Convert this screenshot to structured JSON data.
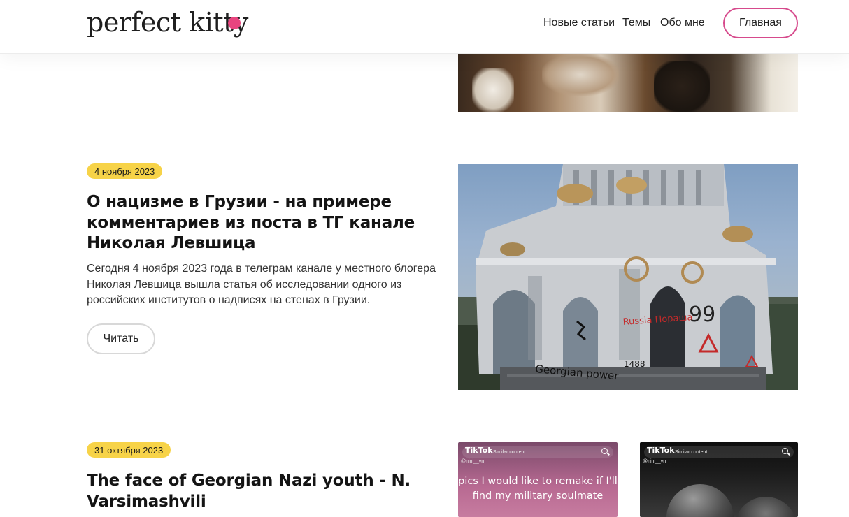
{
  "header": {
    "logo": "perfect kitty",
    "nav": [
      "Новые статьи",
      "Темы",
      "Обо мне"
    ],
    "home_button": "Главная"
  },
  "articles": [
    {
      "date": "4 ноября 2023",
      "title": "О нацизме в Грузии - на примере комментариев из поста в ТГ канале Николая Левшица",
      "excerpt": "Сегодня 4 ноября 2023 года в телеграм канале у местного блогера Николая Левшица вышла статья об исследовании одного из российских институтов о надписях на стенах в Грузии.",
      "read_button": "Читать",
      "image_graffiti": [
        "Georgian power",
        "Russia Пораша",
        "1488",
        "99"
      ]
    },
    {
      "date": "31 октября 2023",
      "title": "The face of Georgian Nazi youth - N. Varsimashvili",
      "thumbs": [
        {
          "brand": "TikTok",
          "sub": "Similar content",
          "user": "@nini__vn",
          "caption": "pics I would like to remake if I'll find my military soulmate"
        },
        {
          "brand": "TikTok",
          "sub": "Similar content",
          "user": "@nini__vn"
        }
      ]
    }
  ],
  "colors": {
    "accent_pink": "#e8457f",
    "badge_yellow": "#f7d348",
    "home_border": "#d64a8c"
  }
}
